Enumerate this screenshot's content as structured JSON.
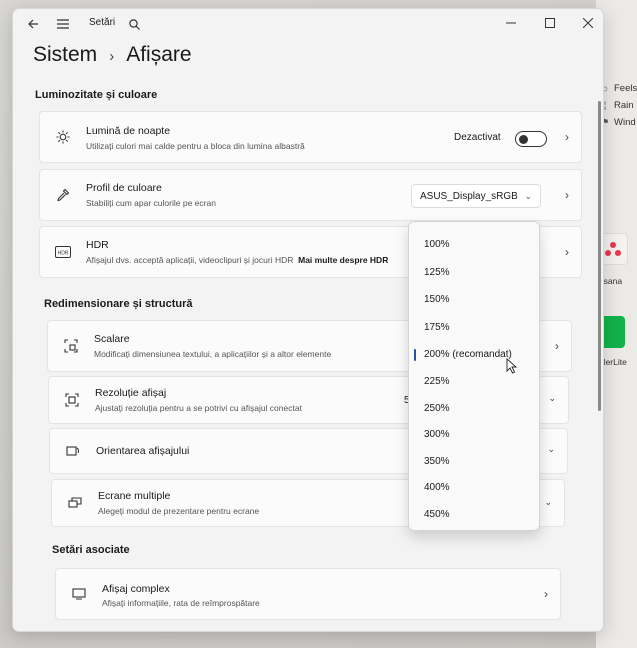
{
  "window": {
    "app_title": "Setări",
    "back_icon": "back-arrow-icon",
    "menu_icon": "hamburger-menu-icon",
    "search_icon": "search-icon"
  },
  "breadcrumb": {
    "parent": "Sistem",
    "separator": "›",
    "current": "Afișare"
  },
  "sections": {
    "brightness": "Luminozitate și culoare",
    "scale_layout": "Redimensionare și structură",
    "related": "Setări asociate"
  },
  "night_light": {
    "title": "Lumină de noapte",
    "subtitle": "Utilizați culori mai calde pentru a bloca din lumina albastră",
    "state": "Dezactivat"
  },
  "color_profile": {
    "title": "Profil de culoare",
    "subtitle": "Stabiliți cum apar culorile pe ecran",
    "value": "ASUS_Display_sRGB"
  },
  "hdr": {
    "title": "HDR",
    "subtitle": "Afișajul dvs. acceptă aplicații, videoclipuri și jocuri HDR",
    "link": "Mai multe despre HDR"
  },
  "scale": {
    "title": "Scalare",
    "subtitle": "Modificați dimensiunea textului, a aplicațiilor și a altor elemente"
  },
  "resolution": {
    "title": "Rezoluție afișaj",
    "subtitle": "Ajustați rezoluția pentru a se potrivi cu afișajul conectat",
    "value_partial": "5"
  },
  "orientation": {
    "title": "Orientarea afișajului"
  },
  "multiple": {
    "title": "Ecrane multiple",
    "subtitle": "Alegeți modul de prezentare pentru ecrane"
  },
  "advanced": {
    "title": "Afișaj complex",
    "subtitle": "Afișați informațiile, rata de reîmprospătare"
  },
  "scale_options": [
    "100%",
    "125%",
    "150%",
    "175%",
    "200% (recomandat)",
    "225%",
    "250%",
    "300%",
    "350%",
    "400%",
    "450%"
  ],
  "selected_scale": "200% (recomandat)",
  "desktop": {
    "weather": [
      "Feels",
      "Rain",
      "Wind"
    ],
    "tiles": [
      "Asana",
      "MailerLite"
    ]
  },
  "colors": {
    "accent": "#2d4fa0",
    "asana": "#e8384f",
    "mailerlite": "#14b34a"
  }
}
